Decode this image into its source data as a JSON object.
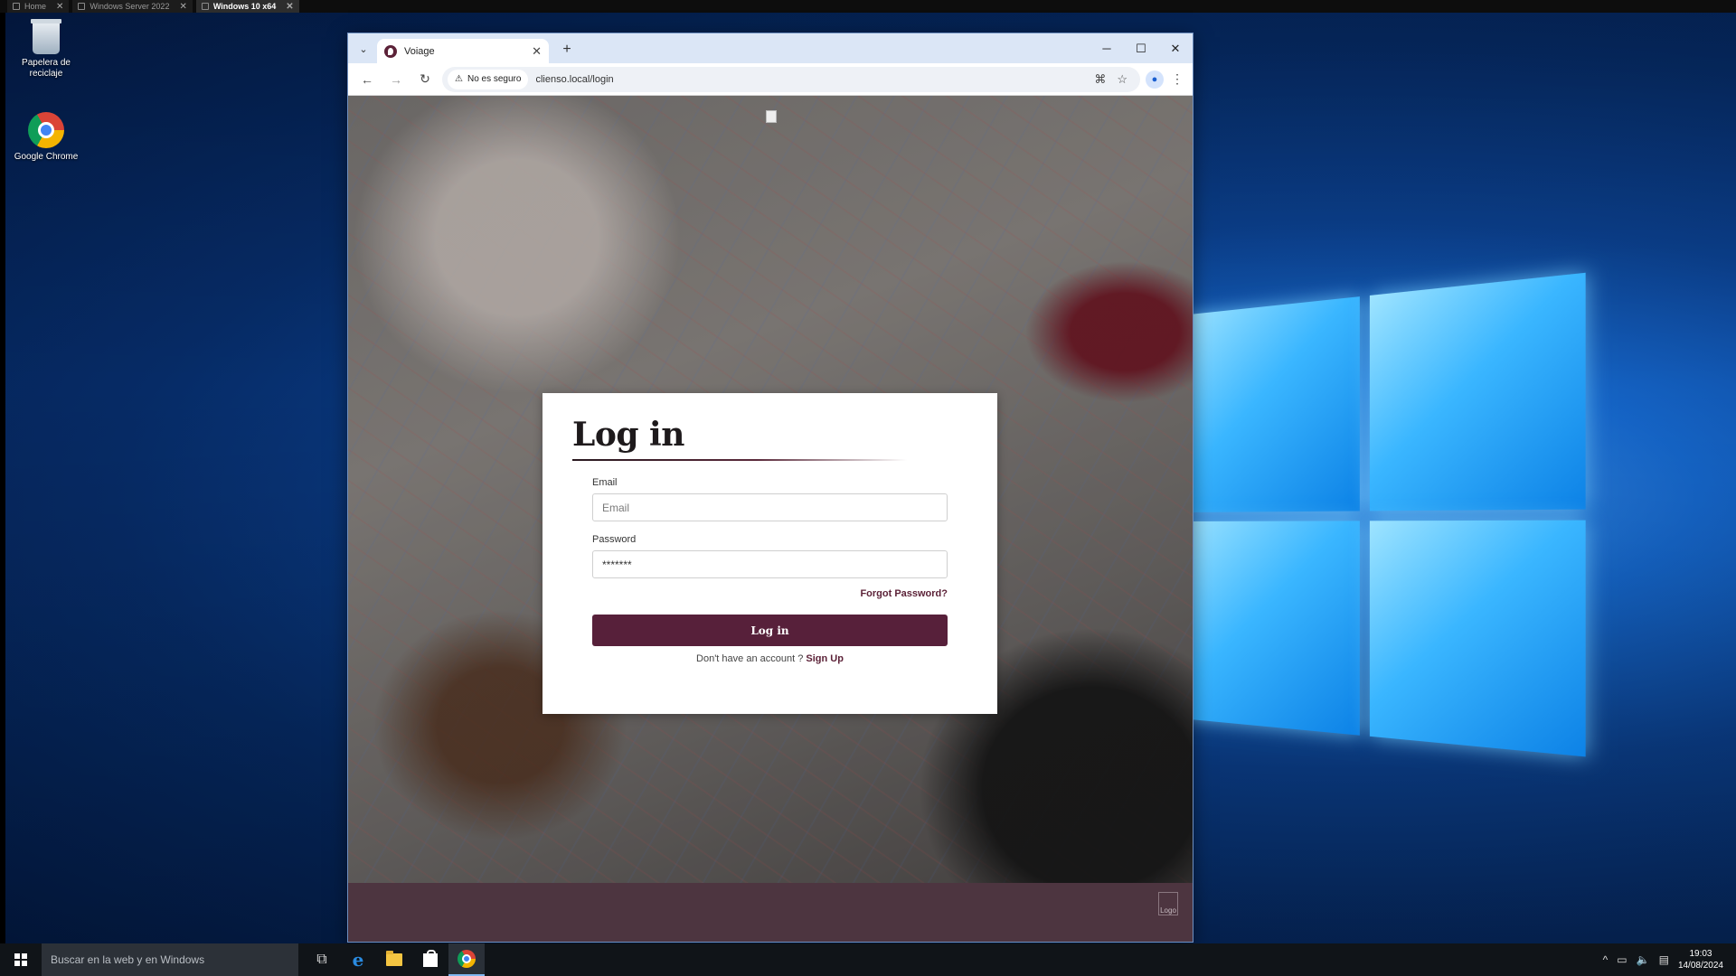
{
  "vm_tabs": [
    {
      "label": "Home",
      "active": false
    },
    {
      "label": "Windows Server 2022",
      "active": false
    },
    {
      "label": "Windows 10 x64",
      "active": true
    }
  ],
  "desktop": {
    "icons": [
      {
        "label": "Papelera de reciclaje",
        "icon": "recycle-bin-icon"
      },
      {
        "label": "Google Chrome",
        "icon": "chrome-icon"
      }
    ]
  },
  "browser": {
    "tab": {
      "title": "Voiage",
      "close": "✕",
      "favicon": "voiage-favicon"
    },
    "new_tab": "+",
    "window_controls": {
      "minimize": "─",
      "maximize": "☐",
      "close": "✕"
    },
    "nav": {
      "back": "←",
      "forward": "→",
      "reload": "↻"
    },
    "security": {
      "icon": "⚠",
      "label": "No es seguro"
    },
    "url": "clienso.local/login",
    "toolbar_icons": {
      "translate": "⌘",
      "bookmark": "☆",
      "profile": "👤",
      "menu": "⋮"
    }
  },
  "page": {
    "login": {
      "title": "Log in",
      "email_label": "Email",
      "email_placeholder": "Email",
      "password_label": "Password",
      "password_value": "*******",
      "forgot": "Forgot Password?",
      "submit": "Log in",
      "signup_prompt": "Don't have an account ?",
      "signup_link": "Sign Up"
    },
    "footer": {
      "logo_alt": "Logo"
    },
    "colors": {
      "brand": "#57203a",
      "footer": "#4d3540"
    }
  },
  "taskbar": {
    "search_placeholder": "Buscar en la web y en Windows",
    "clock_time": "19:03",
    "clock_date": "14/08/2024"
  }
}
